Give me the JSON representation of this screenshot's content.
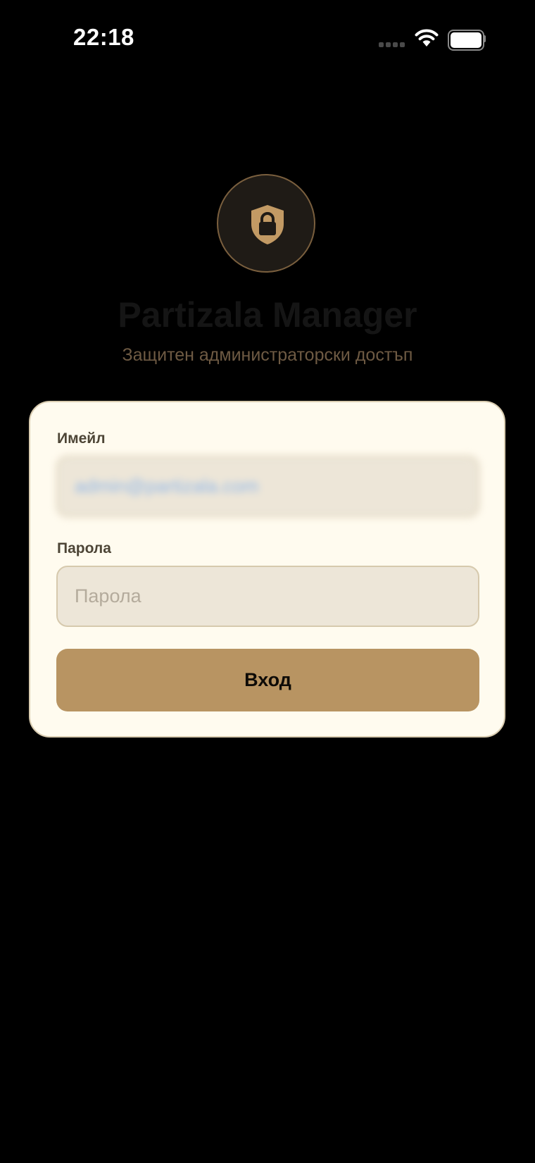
{
  "status_bar": {
    "time": "22:18",
    "icons": [
      "signal-icon",
      "wifi-icon",
      "battery-icon"
    ]
  },
  "header": {
    "logo_icon": "shield-lock-icon",
    "title": "Partizala Manager",
    "subtitle": "Защитен администраторски достъп"
  },
  "login_form": {
    "email": {
      "label": "Имейл",
      "value": "admin@partizala.com",
      "blurred": true
    },
    "password": {
      "label": "Парола",
      "placeholder": "Парола",
      "value": ""
    },
    "submit_label": "Вход"
  },
  "colors": {
    "background": "#000000",
    "card": "#fffbef",
    "accent": "#b89462",
    "input_bg": "#ede6d8",
    "subtitle": "#6e5a43"
  }
}
